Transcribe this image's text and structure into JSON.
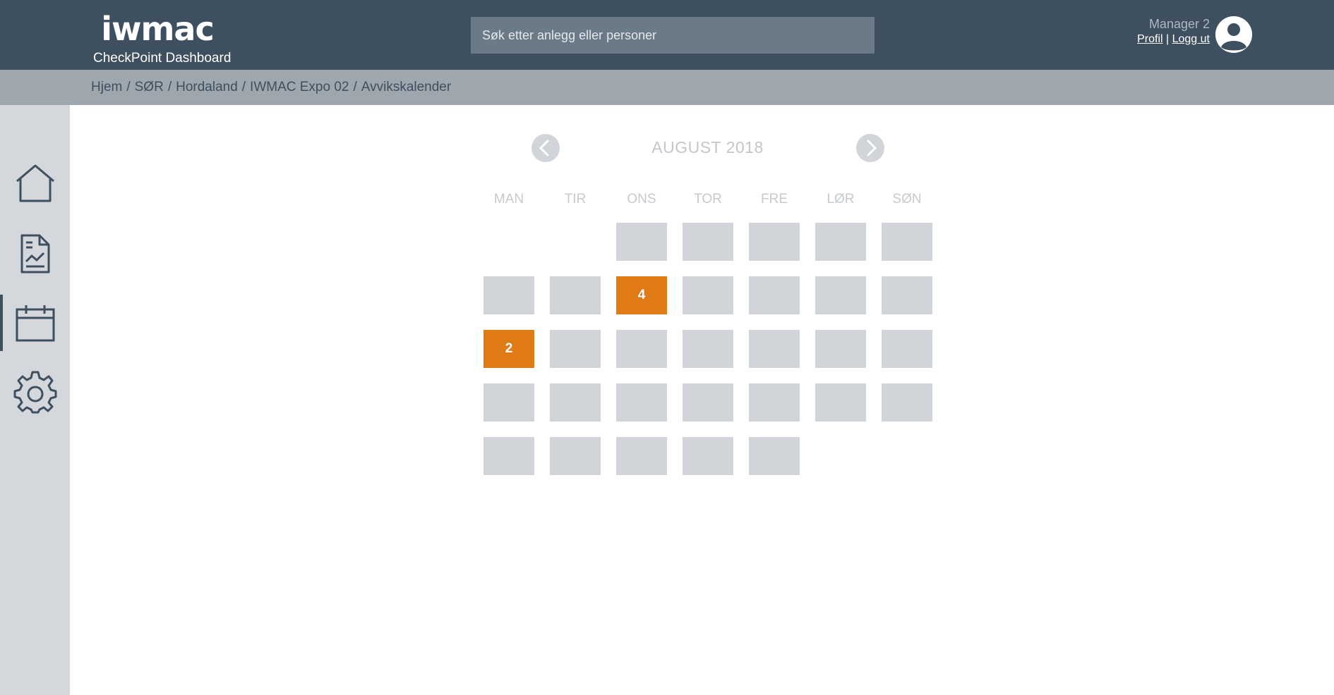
{
  "header": {
    "logo_text": "iwmac",
    "app_subtitle": "CheckPoint Dashboard",
    "search": {
      "placeholder": "Søk etter anlegg eller personer",
      "value": ""
    },
    "user": {
      "name": "Manager 2",
      "profile_link": "Profil",
      "separator": "|",
      "logout_link": "Logg ut"
    },
    "bg_color": "#3e4f5f"
  },
  "breadcrumb": [
    "Hjem",
    "SØR",
    "Hordaland",
    "IWMAC Expo 02",
    "Avvikskalender"
  ],
  "sidebar": {
    "items": [
      {
        "icon": "home-icon",
        "active": false
      },
      {
        "icon": "report-icon",
        "active": false
      },
      {
        "icon": "calendar-icon",
        "active": true
      },
      {
        "icon": "gear-icon",
        "active": false
      }
    ]
  },
  "calendar": {
    "month_label": "AUGUST 2018",
    "weekdays": [
      "MAN",
      "TIR",
      "ONS",
      "TOR",
      "FRE",
      "LØR",
      "SØN"
    ],
    "flag_color": "#df7a14",
    "weeks": [
      [
        null,
        null,
        "",
        "",
        "",
        "",
        ""
      ],
      [
        "",
        "",
        "4",
        "",
        "",
        "",
        ""
      ],
      [
        "2",
        "",
        "",
        "",
        "",
        "",
        ""
      ],
      [
        "",
        "",
        "",
        "",
        "",
        "",
        ""
      ],
      [
        "",
        "",
        "",
        "",
        "",
        null,
        null
      ]
    ]
  }
}
